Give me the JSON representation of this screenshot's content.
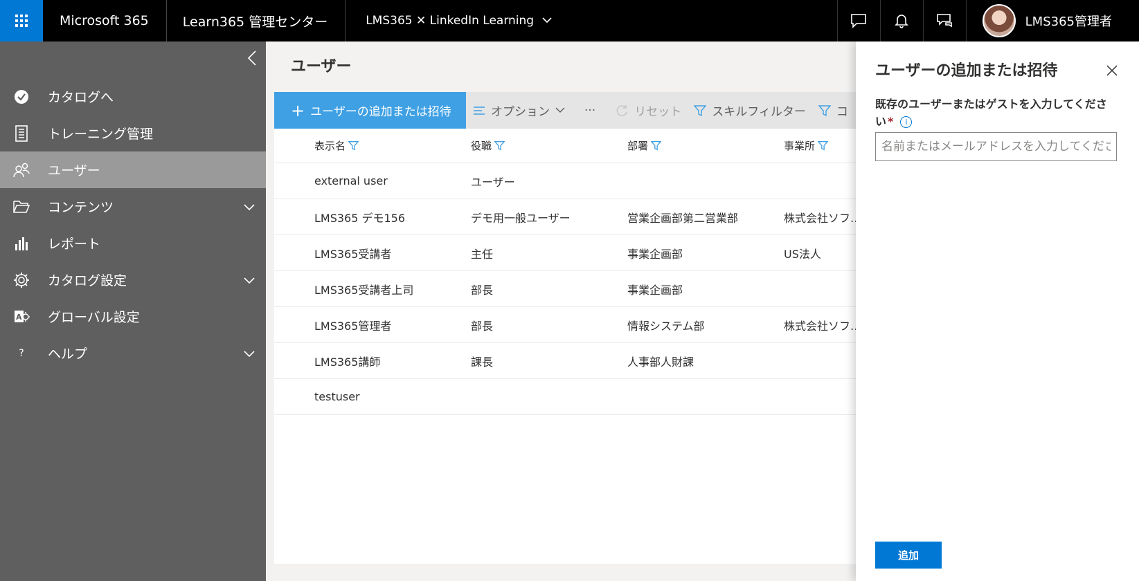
{
  "header": {
    "brand": "Microsoft 365",
    "app_title": "Learn365 管理センター",
    "tenant": "LMS365 ✕ LinkedIn Learning",
    "user_name": "LMS365管理者",
    "icons": [
      "chat-icon",
      "bell-icon",
      "feedback-icon"
    ]
  },
  "sidebar": {
    "items": [
      {
        "label": "カタログへ",
        "icon": "catalog-check-icon"
      },
      {
        "label": "トレーニング管理",
        "icon": "training-icon"
      },
      {
        "label": "ユーザー",
        "icon": "users-icon",
        "active": true
      },
      {
        "label": "コンテンツ",
        "icon": "folder-icon",
        "expandable": true
      },
      {
        "label": "レポート",
        "icon": "report-icon"
      },
      {
        "label": "カタログ設定",
        "icon": "gear-icon",
        "expandable": true
      },
      {
        "label": "グローバル設定",
        "icon": "global-settings-icon"
      },
      {
        "label": "ヘルプ",
        "icon": "help-icon",
        "expandable": true
      }
    ]
  },
  "main": {
    "title": "ユーザー",
    "toolbar": {
      "add_label": "ユーザーの追加または招待",
      "options_label": "オプション",
      "more_label": "···",
      "reset_label": "リセット",
      "skill_filter_label": "スキルフィルター",
      "next_filter_label": "コ"
    },
    "table": {
      "columns": [
        "表示名",
        "役職",
        "部署",
        "事業所"
      ],
      "rows": [
        [
          "external user",
          "ユーザー",
          "",
          ""
        ],
        [
          "LMS365 デモ156",
          "デモ用一般ユーザー",
          "営業企画部第二営業部",
          "株式会社ソフ…"
        ],
        [
          "LMS365受講者",
          "主任",
          "事業企画部",
          "US法人"
        ],
        [
          "LMS365受講者上司",
          "部長",
          "事業企画部",
          ""
        ],
        [
          "LMS365管理者",
          "部長",
          "情報システム部",
          "株式会社ソフ…"
        ],
        [
          "LMS365講師",
          "課長",
          "人事部人財課",
          ""
        ],
        [
          "testuser",
          "",
          "",
          ""
        ]
      ]
    }
  },
  "panel": {
    "title": "ユーザーの追加または招待",
    "field_label": "既存のユーザーまたはゲストを入力してください",
    "required_mark": "*",
    "info_icon": "i",
    "input_placeholder": "名前またはメールアドレスを入力してください",
    "submit_label": "追加"
  },
  "colors": {
    "accent": "#0078d4",
    "add_button": "#3fa0e4",
    "sidebar_bg": "#5f5f5f",
    "sidebar_active": "#9a9a9a",
    "topbar": "#000000"
  }
}
